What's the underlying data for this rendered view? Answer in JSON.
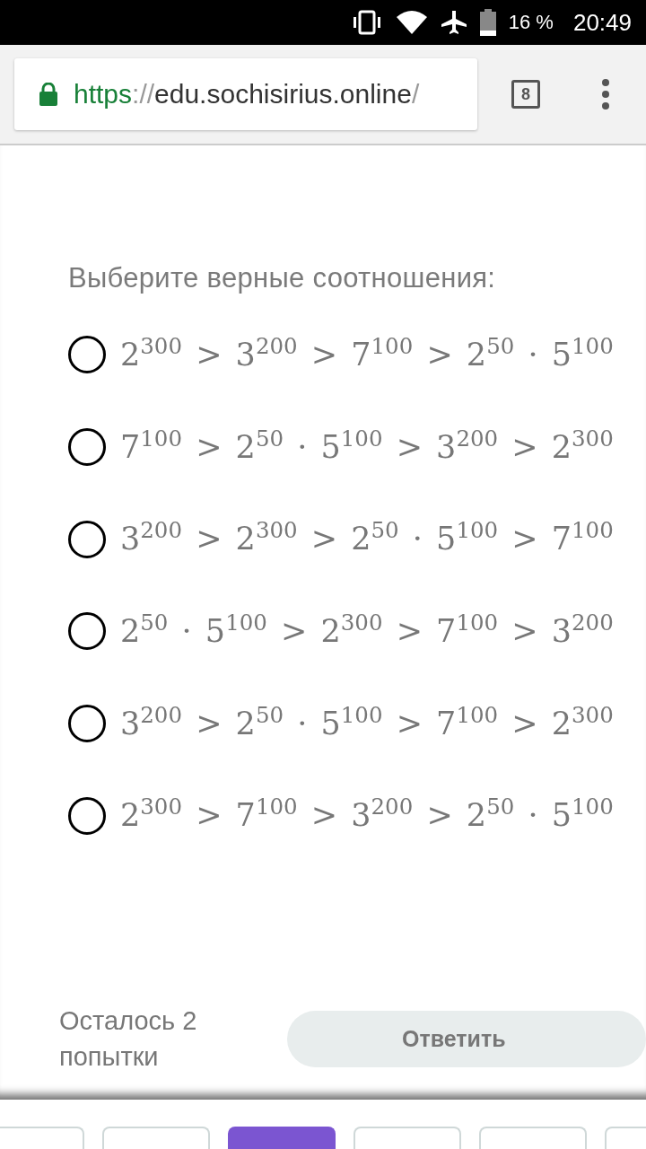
{
  "status_bar": {
    "battery": "16 %",
    "time": "20:49"
  },
  "browser": {
    "url": {
      "scheme": "https",
      "separator": "://",
      "host": "edu.sochisirius.online",
      "path": "/"
    },
    "tab_count": "8"
  },
  "question": {
    "prompt": "Выберите верные соотношения:",
    "options": [
      {
        "text": "2$^{300}$ > 3$^{200}$ > 7$^{100}$ > 2$^{50}$ · 5$^{100}$",
        "checked": false
      },
      {
        "text": "7$^{100}$ > 2$^{50}$ · 5$^{100}$ > 3$^{200}$ > 2$^{300}$",
        "checked": false
      },
      {
        "text": "3$^{200}$ > 2$^{300}$ > 2$^{50}$ · 5$^{100}$ > 7$^{100}$",
        "checked": false
      },
      {
        "text": "2$^{50}$ · 5$^{100}$ > 2$^{300}$ > 7$^{100}$ > 3$^{200}$",
        "checked": false
      },
      {
        "text": "3$^{200}$ > 2$^{50}$ · 5$^{100}$ > 7$^{100}$ > 2$^{300}$",
        "checked": false
      },
      {
        "text": "2$^{300}$ > 7$^{100}$ > 3$^{200}$ > 2$^{50}$ · 5$^{100}$",
        "checked": false
      }
    ]
  },
  "footer": {
    "attempts": "Осталось 2 попытки",
    "submit": "Ответить"
  },
  "question_nav": [
    {
      "selected": false
    },
    {
      "selected": false
    },
    {
      "selected": true
    },
    {
      "selected": false
    },
    {
      "selected": false
    },
    {
      "selected": false
    }
  ]
}
